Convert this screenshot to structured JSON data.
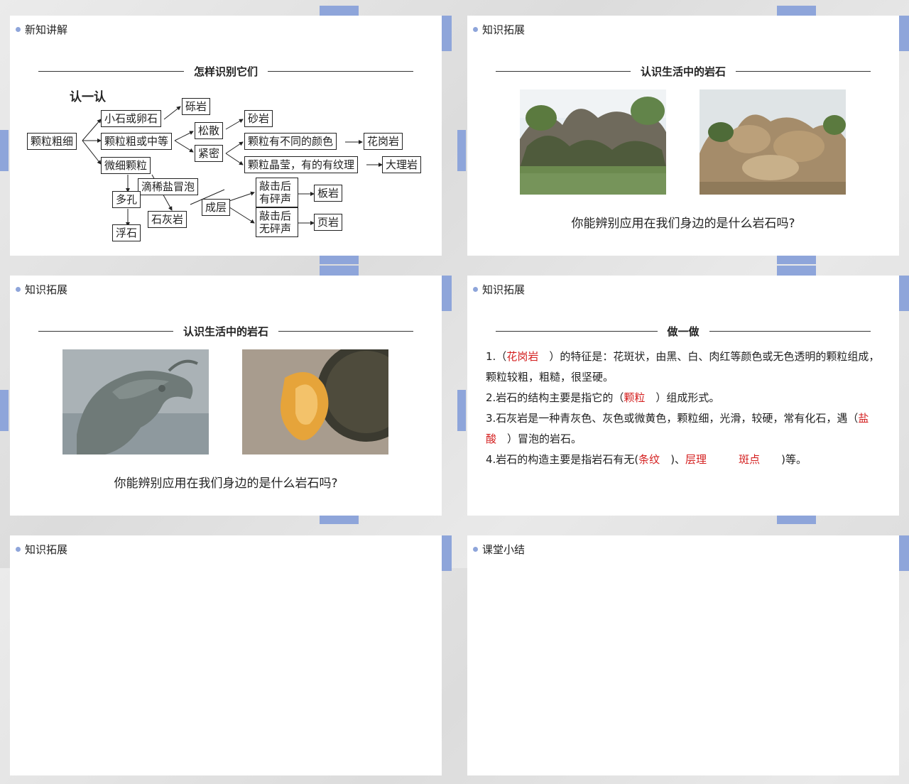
{
  "slides": [
    {
      "header": "新知讲解",
      "title": "怎样识别它们",
      "subheading": "认一认",
      "diagram": {
        "root": "颗粒粗细",
        "small_stones": "小石或卵石",
        "conglomerate": "砾岩",
        "coarse_medium": "颗粒粗或中等",
        "loose": "松散",
        "sandstone": "砂岩",
        "dense": "紧密",
        "diff_colors": "颗粒有不同的颜色",
        "granite": "花岗岩",
        "crystal_texture": "颗粒晶莹，有的有纹理",
        "marble": "大理岩",
        "fine": "微细颗粒",
        "acid_bubbles": "滴稀盐冒泡",
        "porous": "多孔",
        "pumice": "浮石",
        "limestone": "石灰岩",
        "layered": "成层",
        "crisp_sound": "敲击后\n有砰声",
        "slate": "板岩",
        "no_crisp_sound": "敲击后\n无砰声",
        "shale": "页岩"
      }
    },
    {
      "header": "知识拓展",
      "title": "认识生活中的岩石",
      "question": "你能辨别应用在我们身边的是什么岩石吗?"
    },
    {
      "header": "知识拓展",
      "title": "认识生活中的岩石",
      "question": "你能辨别应用在我们身边的是什么岩石吗?"
    },
    {
      "header": "知识拓展",
      "title": "做一做",
      "items": [
        {
          "pre": "1.（",
          "ans": "花岗岩",
          "post": "　）的特征是：花斑状，由黑、白、肉红等颜色或无色透明的颗粒组成，颗粒较粗，粗糙，很坚硬。"
        },
        {
          "pre": "2.岩石的结构主要是指它的（",
          "ans": "颗粒",
          "post": "　）组成形式。"
        },
        {
          "pre": "3.石灰岩是一种青灰色、灰色或微黄色，颗粒细，光滑，较硬，常有化石，遇（",
          "ans": "盐酸",
          "post": "　）冒泡的岩石。"
        },
        {
          "pre": "4.岩石的构造主要是指岩石有无(",
          "ans1": "条纹",
          "mid": "　)、",
          "ans2": "层理",
          "ans3": "斑点",
          "post": "　　)等。"
        }
      ]
    },
    {
      "header": "知识拓展"
    },
    {
      "header": "课堂小结"
    }
  ],
  "colors": {
    "accent": "#8ea5da",
    "answer": "#d42020"
  }
}
